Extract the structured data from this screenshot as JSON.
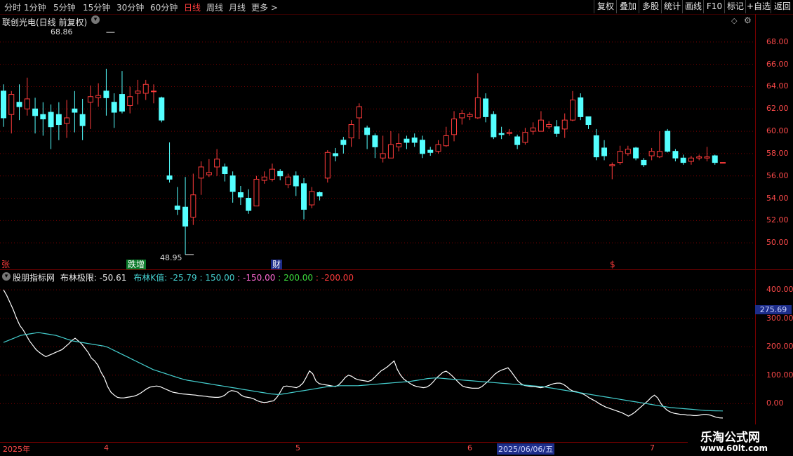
{
  "toolbar": {
    "periods": [
      "分时",
      "1分钟",
      "5分钟",
      "15分钟",
      "30分钟",
      "60分钟",
      "日线",
      "周线",
      "月线",
      "更多 >"
    ],
    "active_period": "日线",
    "actions": [
      "复权",
      "叠加",
      "多股",
      "统计",
      "画线",
      "F10",
      "标记",
      "+自选",
      "返回"
    ]
  },
  "main_panel": {
    "title": "联创光电(日线 前复权)",
    "high_label": "68.86",
    "low_label": "48.95",
    "markers": [
      "张",
      "跌增",
      "财",
      "$"
    ],
    "colors": {
      "up": "#ff3b3b",
      "down": "#54ffff",
      "grid": "#7a0000",
      "axis_text": "#ff4a4a"
    }
  },
  "sub_panel": {
    "indicator_name": "股朋指标网",
    "limit_label": "布林极限:",
    "limit_value": "-50.61",
    "k_label": "布林K值:",
    "k_value": "-25.79",
    "levels": [
      "150.00",
      "-150.00",
      "200.00",
      "-200.00"
    ],
    "current_value": "275.69"
  },
  "date_axis": [
    "2025年",
    "4",
    "5",
    "6",
    "2025/06/06/五",
    "7"
  ],
  "watermark": {
    "name": "乐淘公式网",
    "url": "www.60lt.com"
  },
  "chart_data": [
    {
      "type": "candlestick",
      "title": "联创光电(日线 前复权)",
      "y_ticks": [
        50,
        52,
        54,
        56,
        58,
        60,
        62,
        64,
        66,
        68
      ],
      "ylim": [
        48.5,
        70
      ],
      "high": 68.86,
      "low": 48.95,
      "candles": [
        [
          63.6,
          61.2,
          64.2,
          60.4
        ],
        [
          61.5,
          63.3,
          63.6,
          59.8
        ],
        [
          62.6,
          62.2,
          64.2,
          61.0
        ],
        [
          62.0,
          62.9,
          64.8,
          61.4
        ],
        [
          62.0,
          61.4,
          63.0,
          59.8
        ],
        [
          61.5,
          61.1,
          62.6,
          59.6
        ],
        [
          61.7,
          60.4,
          62.4,
          58.4
        ],
        [
          61.5,
          60.6,
          62.6,
          59.2
        ],
        [
          60.7,
          61.2,
          62.8,
          59.4
        ],
        [
          62.0,
          61.7,
          63.6,
          59.9
        ],
        [
          61.5,
          60.5,
          62.9,
          59.2
        ],
        [
          62.6,
          63.1,
          64.1,
          60.2
        ],
        [
          63.0,
          63.2,
          64.3,
          62.2
        ],
        [
          63.6,
          63.0,
          65.6,
          61.4
        ],
        [
          62.6,
          61.7,
          63.4,
          60.3
        ],
        [
          63.3,
          61.8,
          65.4,
          61.6
        ],
        [
          62.3,
          63.1,
          64.0,
          61.6
        ],
        [
          63.4,
          63.6,
          64.6,
          62.4
        ],
        [
          63.4,
          64.2,
          64.6,
          62.8
        ],
        [
          63.6,
          63.6,
          64.2,
          62.5
        ],
        [
          63.0,
          61.0,
          63.1,
          60.8
        ],
        [
          56.0,
          55.7,
          59.0,
          55.4
        ],
        [
          53.3,
          53.0,
          55.0,
          52.5
        ],
        [
          53.2,
          51.5,
          55.9,
          48.95
        ],
        [
          52.3,
          54.3,
          56.2,
          51.6
        ],
        [
          55.8,
          56.8,
          57.3,
          54.3
        ],
        [
          56.1,
          56.3,
          57.5,
          55.9
        ],
        [
          56.8,
          57.5,
          58.4,
          56.0
        ],
        [
          56.8,
          56.2,
          57.1,
          55.5
        ],
        [
          56.0,
          54.6,
          56.4,
          53.6
        ],
        [
          54.5,
          54.1,
          55.1,
          53.4
        ],
        [
          54.0,
          52.9,
          54.8,
          52.6
        ],
        [
          53.3,
          55.7,
          56.0,
          53.3
        ],
        [
          55.6,
          55.9,
          56.4,
          55.3
        ],
        [
          55.7,
          56.6,
          57.1,
          55.5
        ],
        [
          56.4,
          56.0,
          56.6,
          55.6
        ],
        [
          55.2,
          55.9,
          56.2,
          54.9
        ],
        [
          56.0,
          55.1,
          56.4,
          54.2
        ],
        [
          55.3,
          53.0,
          55.8,
          52.1
        ],
        [
          53.4,
          54.6,
          55.0,
          53.1
        ],
        [
          54.5,
          54.2,
          54.6,
          53.8
        ],
        [
          55.8,
          58.1,
          58.3,
          55.4
        ],
        [
          58.0,
          57.8,
          58.5,
          57.3
        ],
        [
          59.2,
          58.8,
          59.5,
          58.0
        ],
        [
          59.4,
          60.6,
          61.0,
          58.6
        ],
        [
          61.2,
          62.2,
          62.5,
          59.3
        ],
        [
          60.3,
          59.7,
          60.5,
          58.4
        ],
        [
          59.6,
          58.6,
          59.8,
          57.6
        ],
        [
          57.6,
          58.0,
          59.6,
          57.2
        ],
        [
          57.6,
          58.8,
          60.0,
          57.6
        ],
        [
          58.6,
          58.9,
          59.8,
          58.2
        ],
        [
          59.3,
          59.0,
          59.6,
          58.4
        ],
        [
          59.4,
          59.0,
          59.8,
          58.6
        ],
        [
          59.2,
          58.0,
          59.6,
          57.6
        ],
        [
          58.3,
          58.1,
          58.6,
          57.8
        ],
        [
          58.2,
          58.8,
          59.2,
          58.0
        ],
        [
          58.7,
          59.6,
          60.4,
          58.6
        ],
        [
          59.7,
          61.1,
          61.8,
          59.1
        ],
        [
          61.2,
          61.6,
          61.9,
          60.6
        ],
        [
          61.3,
          61.5,
          61.7,
          61.0
        ],
        [
          61.2,
          63.0,
          65.2,
          61.1
        ],
        [
          62.9,
          61.3,
          63.4,
          60.8
        ],
        [
          61.5,
          59.5,
          61.8,
          59.3
        ],
        [
          59.8,
          59.7,
          60.4,
          59.3
        ],
        [
          59.8,
          59.9,
          60.2,
          59.6
        ],
        [
          59.5,
          58.8,
          59.7,
          58.4
        ],
        [
          59.0,
          59.9,
          60.3,
          58.8
        ],
        [
          60.0,
          60.3,
          60.8,
          59.7
        ],
        [
          60.0,
          61.0,
          61.8,
          60.0
        ],
        [
          60.4,
          60.6,
          60.9,
          60.2
        ],
        [
          60.4,
          59.8,
          61.0,
          59.5
        ],
        [
          60.2,
          61.0,
          61.6,
          59.4
        ],
        [
          61.0,
          62.8,
          63.6,
          60.9
        ],
        [
          63.0,
          61.3,
          63.4,
          61.0
        ],
        [
          61.3,
          60.6,
          61.3,
          60.2
        ],
        [
          59.6,
          57.7,
          60.2,
          57.4
        ],
        [
          58.5,
          57.8,
          59.2,
          57.4
        ],
        [
          56.9,
          57.0,
          57.2,
          55.7
        ],
        [
          57.2,
          58.2,
          58.7,
          57.0
        ],
        [
          58.0,
          58.4,
          58.7,
          57.8
        ],
        [
          58.5,
          57.6,
          58.6,
          57.4
        ],
        [
          57.4,
          57.0,
          57.6,
          56.8
        ],
        [
          57.8,
          58.2,
          58.5,
          57.4
        ],
        [
          57.7,
          58.2,
          60.0,
          57.6
        ],
        [
          60.0,
          58.2,
          60.2,
          58.1
        ],
        [
          58.2,
          57.6,
          58.4,
          57.3
        ],
        [
          57.6,
          57.2,
          57.9,
          57.0
        ],
        [
          57.3,
          57.6,
          57.8,
          57.0
        ],
        [
          57.6,
          57.7,
          57.9,
          57.4
        ],
        [
          57.6,
          57.7,
          58.6,
          57.3
        ],
        [
          57.8,
          57.2,
          57.9,
          57.0
        ],
        [
          57.2,
          57.2,
          57.2,
          57.2
        ]
      ]
    },
    {
      "type": "line",
      "title": "股朋指标网",
      "y_ticks": [
        0,
        100,
        200,
        300,
        400
      ],
      "ylim": [
        -120,
        420
      ],
      "series": [
        {
          "name": "布林极限",
          "color": "#ffffff",
          "values": [
            400,
            380,
            355,
            330,
            300,
            275,
            260,
            240,
            220,
            205,
            190,
            180,
            172,
            165,
            170,
            175,
            180,
            185,
            190,
            200,
            210,
            222,
            230,
            220,
            210,
            195,
            180,
            160,
            150,
            135,
            110,
            90,
            60,
            40,
            30,
            22,
            20,
            20,
            22,
            24,
            26,
            30,
            36,
            44,
            52,
            58,
            60,
            62,
            60,
            55,
            50,
            45,
            40,
            38,
            36,
            34,
            33,
            32,
            31,
            30,
            28,
            27,
            26,
            24,
            23,
            22,
            22,
            24,
            30,
            40,
            46,
            44,
            40,
            30,
            24,
            22,
            20,
            16,
            10,
            6,
            4,
            5,
            8,
            10,
            22,
            40,
            60,
            62,
            60,
            58,
            56,
            62,
            72,
            92,
            115,
            105,
            80,
            70,
            68,
            66,
            64,
            62,
            60,
            66,
            78,
            92,
            100,
            96,
            88,
            84,
            82,
            80,
            78,
            82,
            92,
            104,
            115,
            122,
            130,
            140,
            150,
            120,
            100,
            86,
            78,
            70,
            64,
            60,
            58,
            56,
            58,
            65,
            76,
            90,
            100,
            110,
            114,
            106,
            96,
            84,
            72,
            62,
            58,
            56,
            54,
            54,
            54,
            60,
            70,
            80,
            92,
            104,
            112,
            118,
            122,
            126,
            112,
            96,
            80,
            70,
            64,
            62,
            60,
            60,
            58,
            56,
            58,
            62,
            66,
            70,
            72,
            72,
            68,
            60,
            50,
            44,
            42,
            38,
            34,
            28,
            20,
            14,
            8,
            0,
            -6,
            -12,
            -16,
            -20,
            -24,
            -28,
            -32,
            -38,
            -44,
            -38,
            -30,
            -20,
            -10,
            0,
            10,
            22,
            30,
            20,
            0,
            -14,
            -24,
            -30,
            -34,
            -36,
            -38,
            -38,
            -40,
            -40,
            -42,
            -42,
            -40,
            -38,
            -38,
            -40,
            -44,
            -48,
            -50,
            -50.61
          ]
        },
        {
          "name": "布林K值",
          "color": "#45d0d0",
          "values": [
            215,
            220,
            225,
            230,
            235,
            240,
            242,
            244,
            246,
            248,
            250,
            248,
            246,
            244,
            242,
            240,
            236,
            232,
            228,
            224,
            220,
            218,
            216,
            214,
            212,
            210,
            208,
            206,
            204,
            202,
            198,
            192,
            186,
            180,
            174,
            168,
            162,
            156,
            150,
            144,
            138,
            132,
            126,
            120,
            116,
            112,
            108,
            104,
            100,
            96,
            92,
            88,
            85,
            82,
            80,
            78,
            76,
            74,
            72,
            70,
            68,
            66,
            64,
            62,
            60,
            58,
            56,
            54,
            52,
            50,
            48,
            46,
            44,
            42,
            40,
            38,
            36,
            34,
            33,
            32,
            33,
            35,
            37,
            39,
            41,
            43,
            45,
            47,
            49,
            51,
            53,
            55,
            57,
            59,
            60,
            61,
            62,
            63,
            63,
            63,
            63,
            63,
            63,
            64,
            65,
            66,
            67,
            68,
            69,
            70,
            71,
            72,
            73,
            74,
            75,
            76,
            77,
            78,
            80,
            82,
            84,
            86,
            88,
            89,
            90,
            90,
            89,
            88,
            87,
            86,
            85,
            84,
            83,
            82,
            81,
            80,
            79,
            78,
            77,
            76,
            75,
            74,
            73,
            72,
            71,
            70,
            69,
            68,
            67,
            66,
            65,
            64,
            63,
            62,
            61,
            60,
            58,
            56,
            54,
            52,
            50,
            48,
            46,
            44,
            42,
            40,
            38,
            36,
            34,
            32,
            30,
            28,
            26,
            24,
            22,
            20,
            18,
            16,
            14,
            12,
            10,
            8,
            6,
            4,
            2,
            0,
            -2,
            -4,
            -6,
            -8,
            -10,
            -12,
            -14,
            -15,
            -16,
            -17,
            -18,
            -19,
            -20,
            -21,
            -22,
            -23,
            -24,
            -24.5,
            -25,
            -25.3,
            -25.5,
            -25.79
          ]
        }
      ],
      "reference_levels": [
        150,
        -150,
        200,
        -200
      ]
    }
  ]
}
